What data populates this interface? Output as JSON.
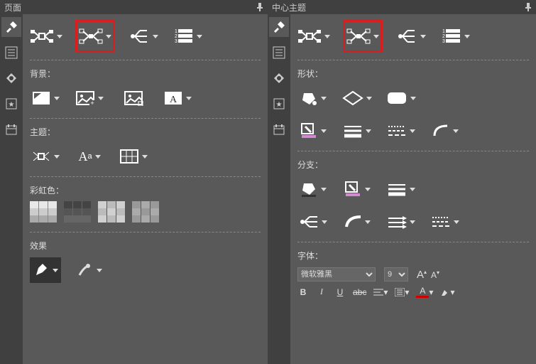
{
  "left": {
    "title": "页面",
    "sections": {
      "background": "背景：",
      "theme": "主题：",
      "rainbow": "彩虹色：",
      "effect": "效果"
    }
  },
  "right": {
    "title": "中心主题",
    "sections": {
      "shape": "形状：",
      "branch": "分支：",
      "font": "字体："
    },
    "font": {
      "family": "微软雅黑",
      "size": "9",
      "bigA": "A",
      "smallA": "A",
      "bold": "B",
      "italic": "I",
      "underline": "U",
      "strike": "abc"
    }
  },
  "pin": "📌"
}
